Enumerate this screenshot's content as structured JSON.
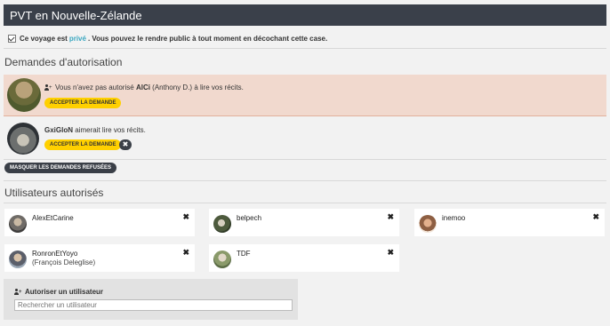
{
  "header": {
    "title": "PVT en Nouvelle-Zélande"
  },
  "privacy": {
    "before": "Ce voyage est",
    "link": "privé",
    "after": ". Vous pouvez le rendre public à tout moment en décochant cette case."
  },
  "requests": {
    "title": "Demandes d'autorisation",
    "items": [
      {
        "prefix": "Vous n'avez pas autorisé",
        "user": "AlCi",
        "realname": "(Anthony D.)",
        "suffix": "à lire vos récits.",
        "accept_label": "ACCEPTER LA DEMANDE"
      },
      {
        "user": "GxiGloN",
        "suffix": "aimerait lire vos récits.",
        "accept_label": "ACCEPTER LA DEMANDE",
        "reject_icon": "close-icon"
      }
    ],
    "hide_refused_label": "MASQUER LES DEMANDES REFUSÉES"
  },
  "authorized": {
    "title": "Utilisateurs autorisés",
    "users": [
      {
        "name": "AlexEtCarine",
        "sub": ""
      },
      {
        "name": "belpech",
        "sub": ""
      },
      {
        "name": "inemoo",
        "sub": ""
      },
      {
        "name": "RonronEtYoyo",
        "sub": "(François Deleglise)"
      },
      {
        "name": "TDF",
        "sub": ""
      }
    ]
  },
  "authorize": {
    "label": "Autoriser un utilisateur",
    "placeholder": "Rechercher un utilisateur"
  },
  "colors": {
    "accent": "#3aa7c0",
    "button_yellow": "#ffd000",
    "header_bg": "#3a404a"
  }
}
